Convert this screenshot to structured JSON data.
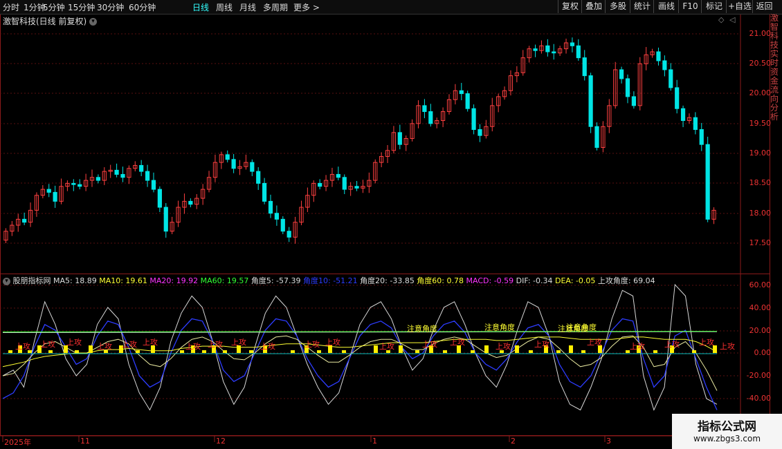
{
  "toolbar": {
    "periods": [
      "分时",
      "1分钟",
      "5分钟",
      "15分钟",
      "30分钟",
      "60分钟",
      "日线",
      "周线",
      "月线",
      "多周期",
      "更多"
    ],
    "active_period": "日线",
    "right_buttons": [
      "复权",
      "叠加",
      "多股",
      "统计",
      "画线",
      "F10",
      "标记",
      "+自选",
      "返回"
    ]
  },
  "main_chart": {
    "title": "激智科技(日线 前复权)",
    "price_ticks": [
      "21.00",
      "20.50",
      "20.00",
      "19.50",
      "19.00",
      "18.50",
      "18.00",
      "17.50"
    ],
    "up_color": "#ff4040",
    "down_color": "#00e5e5"
  },
  "indicator": {
    "name": "股朋指标网",
    "values": [
      {
        "label": "MA5: 18.89",
        "color": "#dddddd"
      },
      {
        "label": "MA10: 19.61",
        "color": "#ffff33"
      },
      {
        "label": "MA20: 19.92",
        "color": "#ff33ff"
      },
      {
        "label": "MA60: 19.57",
        "color": "#33ff33"
      },
      {
        "label": "角度5: -57.39",
        "color": "#dddddd"
      },
      {
        "label": "角度10: -51.21",
        "color": "#2d3cff"
      },
      {
        "label": "角度20: -33.85",
        "color": "#dddddd"
      },
      {
        "label": "角度60: 0.78",
        "color": "#ffff33"
      },
      {
        "label": "MACD: -0.59",
        "color": "#ff33ff"
      },
      {
        "label": "DIF: -0.34",
        "color": "#dddddd"
      },
      {
        "label": "DEA: -0.05",
        "color": "#ffff33"
      },
      {
        "label": "上攻角度: 69.04",
        "color": "#dddddd"
      }
    ],
    "y_ticks": [
      "60.00",
      "40.00",
      "20.00",
      "0.00",
      "-20.00",
      "-40.00"
    ],
    "annotations": [
      "上攻",
      "注意角度"
    ]
  },
  "x_axis": {
    "labels": [
      "2025年",
      "11",
      "12",
      "1",
      "2",
      "3"
    ]
  },
  "right_strip": "激智科技实时资金流向分析",
  "watermark": {
    "line1": "指标公式网",
    "line2": "www.zbgs3.com"
  }
}
